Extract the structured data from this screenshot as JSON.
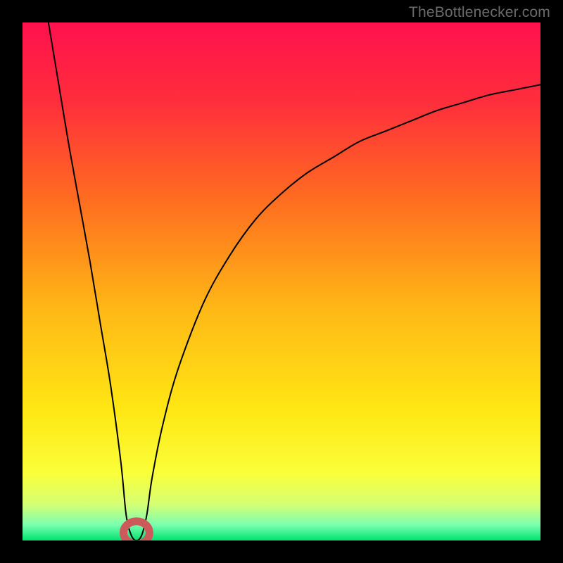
{
  "watermark": "TheBottlenecker.com",
  "chart_data": {
    "type": "line",
    "title": "",
    "xlabel": "",
    "ylabel": "",
    "xlim": [
      0,
      100
    ],
    "ylim": [
      0,
      100
    ],
    "grid": false,
    "legend": "none",
    "background_gradient": {
      "stops": [
        {
          "pos": 0.0,
          "color": "#ff114e"
        },
        {
          "pos": 0.15,
          "color": "#ff2d3c"
        },
        {
          "pos": 0.35,
          "color": "#ff6f1f"
        },
        {
          "pos": 0.55,
          "color": "#ffb716"
        },
        {
          "pos": 0.75,
          "color": "#ffe714"
        },
        {
          "pos": 0.87,
          "color": "#faff3a"
        },
        {
          "pos": 0.93,
          "color": "#d5ff73"
        },
        {
          "pos": 0.97,
          "color": "#7bffb0"
        },
        {
          "pos": 1.0,
          "color": "#00e36e"
        }
      ]
    },
    "series": [
      {
        "name": "bottleneck-curve",
        "stroke": "#000000",
        "stroke_width": 2,
        "x": [
          5,
          7,
          9,
          11,
          13,
          15,
          17,
          19,
          20,
          21,
          22,
          23,
          24,
          25,
          27,
          30,
          35,
          40,
          45,
          50,
          55,
          60,
          65,
          70,
          75,
          80,
          85,
          90,
          95,
          100
        ],
        "y": [
          100,
          88,
          76,
          65,
          54,
          42,
          30,
          15,
          5,
          1,
          0,
          1,
          5,
          12,
          22,
          33,
          46,
          55,
          62,
          67,
          71,
          74,
          77,
          79,
          81,
          83,
          84.5,
          86,
          87,
          88
        ]
      }
    ],
    "marker": {
      "name": "optimal-region",
      "cx": 22,
      "cy": 1.5,
      "rx": 2.5,
      "ry": 2.2,
      "stroke": "#cc5a5a",
      "stroke_width": 11,
      "fill": "none"
    }
  }
}
